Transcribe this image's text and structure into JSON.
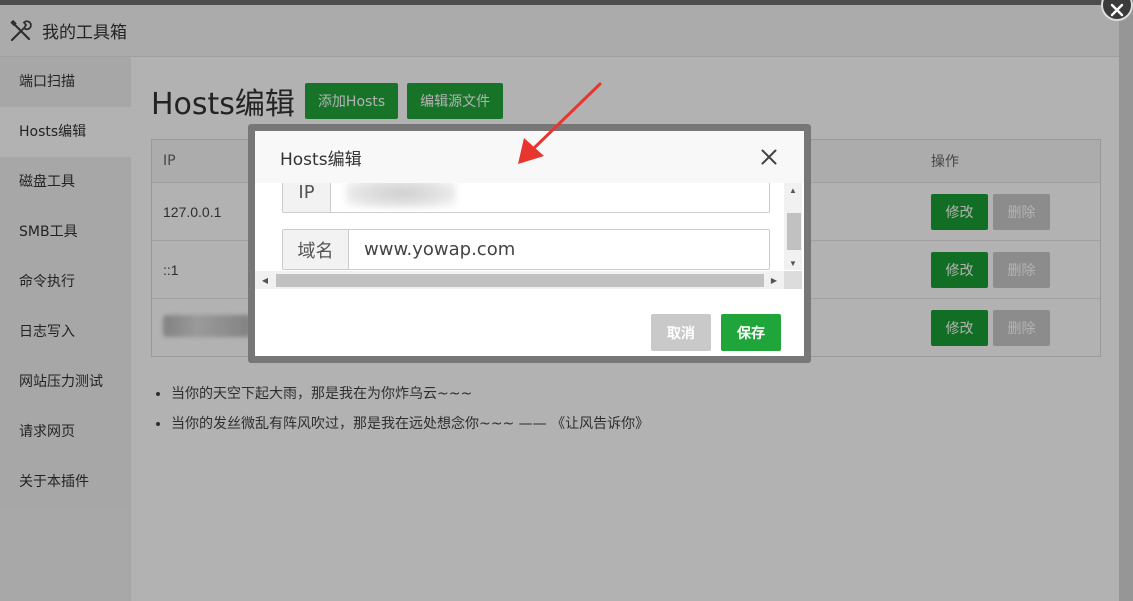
{
  "app": {
    "title": "我的工具箱"
  },
  "sidebar": {
    "items": [
      {
        "label": "端口扫描"
      },
      {
        "label": "Hosts编辑"
      },
      {
        "label": "磁盘工具"
      },
      {
        "label": "SMB工具"
      },
      {
        "label": "命令执行"
      },
      {
        "label": "日志写入"
      },
      {
        "label": "网站压力测试"
      },
      {
        "label": "请求网页"
      },
      {
        "label": "关于本插件"
      }
    ]
  },
  "page": {
    "title": "Hosts编辑",
    "add_button": "添加Hosts",
    "edit_source_button": "编辑源文件"
  },
  "table": {
    "headers": {
      "ip": "IP",
      "ops": "操作"
    },
    "rows": [
      {
        "ip": "127.0.0.1",
        "edit": "修改",
        "delete": "删除"
      },
      {
        "ip": "::1",
        "edit": "修改",
        "delete": "删除"
      },
      {
        "ip": "",
        "edit": "修改",
        "delete": "删除"
      }
    ]
  },
  "notes": [
    "当你的天空下起大雨，那是我在为你炸乌云~~~",
    "当你的发丝微乱有阵风吹过，那是我在远处想念你~~~ —— 《让风告诉你》"
  ],
  "dialog": {
    "title": "Hosts编辑",
    "fields": {
      "ip_label": "IP",
      "ip_value": "",
      "domain_label": "域名",
      "domain_value": "www.yowap.com"
    },
    "cancel": "取消",
    "save": "保存"
  },
  "colors": {
    "accent": "#20a53a",
    "disabled": "#c9c9c9",
    "annotation_arrow": "#e8362f"
  },
  "icons": {
    "app": "tools-icon",
    "dialog_close": "close-icon",
    "window_close": "close-circle-icon"
  }
}
